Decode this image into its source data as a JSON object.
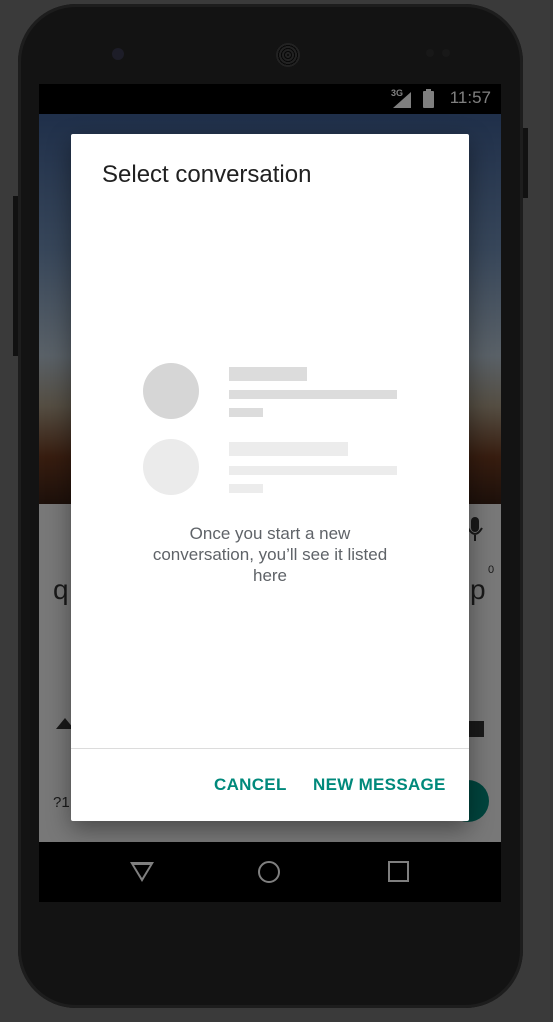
{
  "status_bar": {
    "network": "3G",
    "time": "11:57"
  },
  "background_app": {
    "keyboard_left_char": "q",
    "keyboard_right_char": "p",
    "keyboard_superscript": "0",
    "keyboard_symbols_key": "?1"
  },
  "dialog": {
    "title": "Select conversation",
    "empty_message": "Once you start a new conversation, you’ll see it listed here",
    "cancel_label": "CANCEL",
    "new_message_label": "NEW MESSAGE"
  },
  "colors": {
    "accent": "#00897b",
    "placeholder_avatar_1": "#d6d6d6",
    "placeholder_avatar_2": "#ebebeb",
    "placeholder_bar_1": "#dcdcdc",
    "placeholder_bar_2": "#ececec"
  },
  "nav_bar": {
    "icons": [
      "back-icon",
      "home-icon",
      "recents-icon"
    ]
  }
}
